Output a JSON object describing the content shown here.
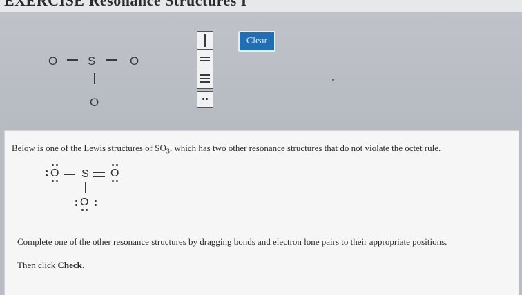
{
  "header": {
    "title": "EXERCISE Resonance Structures I"
  },
  "toolbar": {
    "clear_label": "Clear"
  },
  "canvas": {
    "atoms": {
      "o_left": "O",
      "s_center": "S",
      "o_right": "O",
      "o_bottom": "O"
    }
  },
  "palette": {
    "items": [
      "single-bond",
      "double-bond",
      "triple-bond",
      "lone-pair"
    ]
  },
  "question": {
    "intro_prefix": "Below is one of the Lewis structures of SO",
    "intro_sub": "3",
    "intro_suffix": ", which has two other resonance structures that do not violate the octet rule.",
    "instruction": "Complete one of the other resonance structures by dragging bonds and electron lone pairs to their appropriate positions.",
    "then_prefix": "Then click ",
    "then_bold": "Check",
    "then_suffix": "."
  },
  "example": {
    "atoms": {
      "o_left": "O",
      "s_center": "S",
      "o_right": "O",
      "o_bottom": "O"
    }
  }
}
